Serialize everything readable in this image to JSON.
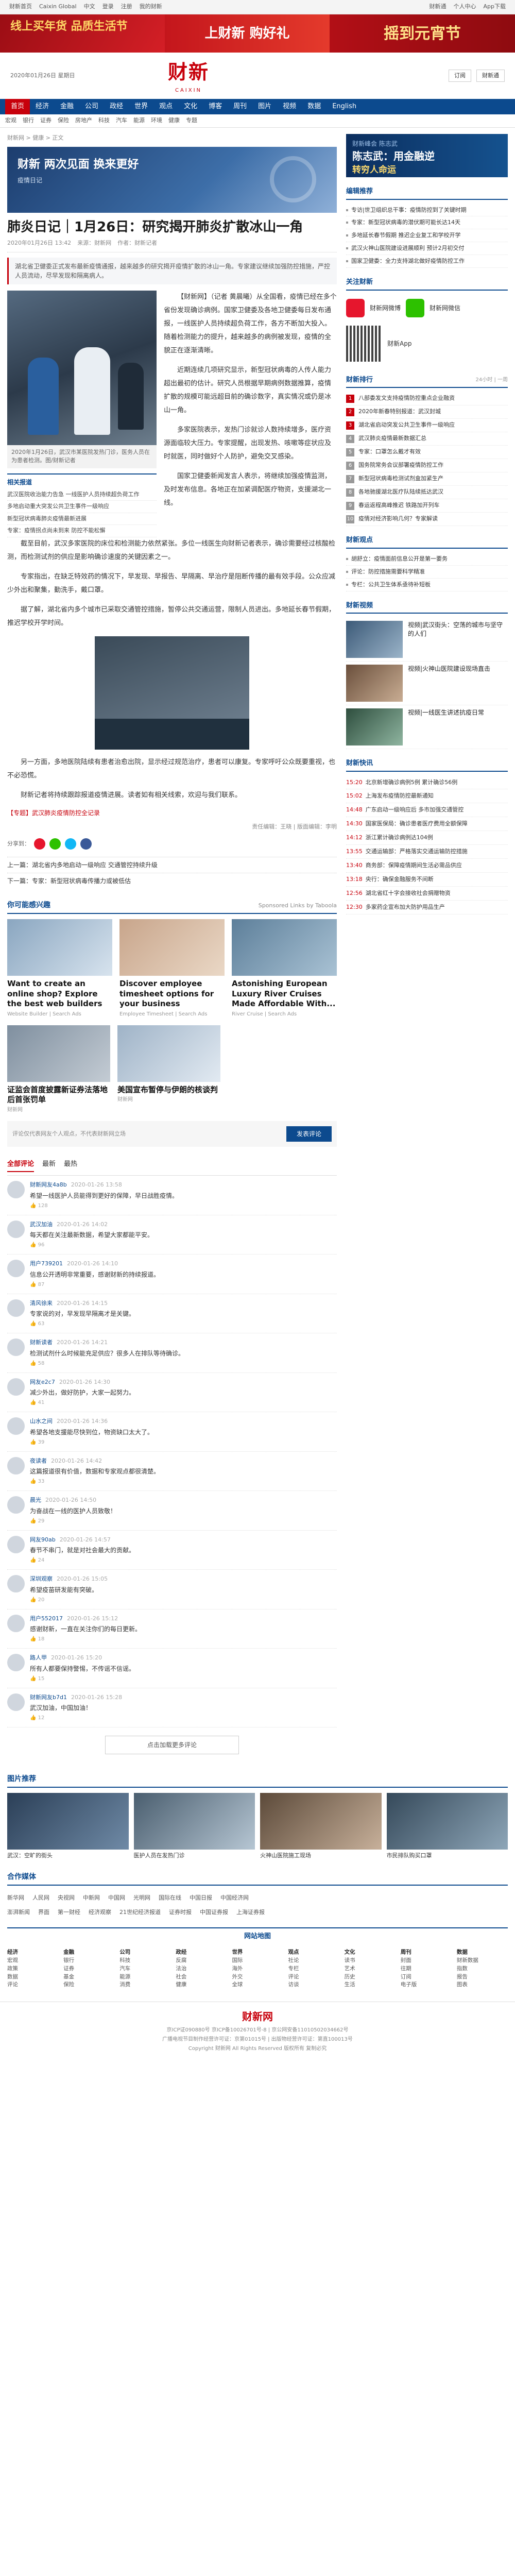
{
  "topbar": {
    "items": [
      "财新首页",
      "Caixin Global",
      "中文",
      "登录",
      "注册",
      "我的财新"
    ],
    "right": [
      "财新通",
      "个人中心",
      "App下载"
    ]
  },
  "adbanner": {
    "left": "线上买年货 品质生活节",
    "mid": "上财新 购好礼",
    "right": "摇到元宵节"
  },
  "masthead": {
    "date": "2020年01月26日 星期日",
    "logo_cn": "财新",
    "logo_en": "CAIXIN",
    "buttons": [
      "订阅",
      "财新通"
    ]
  },
  "nav": {
    "items": [
      "首页",
      "经济",
      "金融",
      "公司",
      "政经",
      "世界",
      "观点",
      "文化",
      "博客",
      "周刊",
      "图片",
      "视频",
      "数据",
      "English"
    ],
    "active": 0
  },
  "subnav": {
    "items": [
      "宏观",
      "银行",
      "证券",
      "保险",
      "房地产",
      "科技",
      "汽车",
      "能源",
      "环境",
      "健康",
      "专题"
    ]
  },
  "crumb": "财新网 > 健康 > 正文",
  "hero": {
    "tag": "财新 两次见面 换来更好",
    "sub": "疫情日记"
  },
  "article": {
    "title": "肺炎日记｜1月26日：研究揭开肺炎扩散冰山一角",
    "meta": [
      "2020年01月26日 13:42",
      "来源：财新网",
      "作者：财新记者"
    ],
    "summary": "湖北省卫健委正式发布最新疫情通报，越来越多的研究揭开疫情扩散的冰山一角。专家建议继续加强防控措施，严控人员流动，尽早发现和隔离病人。",
    "caption": "2020年1月26日，武汉市某医院发热门诊，医务人员在为患者检测。图/财新记者",
    "related_h": "相关报道",
    "related": [
      "武汉医院收治能力告急 一线医护人员持续超负荷工作",
      "多地启动重大突发公共卫生事件一级响应",
      "新型冠状病毒肺炎疫情最新进展",
      "专家：疫情拐点尚未到来 防控不能松懈"
    ],
    "paras": [
      "【财新网】（记者 黄晨曦）从全国看，疫情已经在多个省份发现确诊病例。国家卫健委及各地卫健委每日发布通报，一线医护人员持续超负荷工作，各方不断加大投入。随着检测能力的提升，越来越多的病例被发现，疫情的全貌正在逐渐清晰。",
      "近期连续几项研究显示，新型冠状病毒的人传人能力超出最初的估计。研究人员根据早期病例数据推算，疫情扩散的规模可能远超目前的确诊数字，真实情况或仍是冰山一角。",
      "多家医院表示，发热门诊就诊人数持续增多，医疗资源面临较大压力。专家提醒，出现发热、咳嗽等症状应及时就医，同时做好个人防护，避免交叉感染。",
      "国家卫健委新闻发言人表示，将继续加强疫情监测，及时发布信息。各地正在加紧调配医疗物资，支援湖北一线。"
    ],
    "paras2": [
      "截至目前，武汉多家医院的床位和检测能力依然紧张。多位一线医生向财新记者表示，确诊需要经过核酸检测，而检测试剂的供应是影响确诊速度的关键因素之一。",
      "专家指出，在缺乏特效药的情况下，早发现、早报告、早隔离、早治疗是阻断传播的最有效手段。公众应减少外出和聚集，勤洗手，戴口罩。",
      "据了解，湖北省内多个城市已采取交通管控措施，暂停公共交通运营，限制人员进出。多地延长春节假期，推迟学校开学时间。",
      "另一方面，多地医院陆续有患者治愈出院，显示经过规范治疗，患者可以康复。专家呼吁公众既要重视，也不必恐慌。",
      "财新记者将持续跟踪报道疫情进展。读者如有相关线索，欢迎与我们联系。"
    ],
    "note_red": "【专题】武汉肺炎疫情防控全记录",
    "editor": "责任编辑：王晓 | 版面编辑：李明",
    "share_label": "分享到：",
    "prev": "上一篇：湖北省内多地启动一级响应 交通管控持续升级",
    "next": "下一篇：专家：新型冠状病毒传播力或被低估"
  },
  "recommend": {
    "title": "你可能感兴趣",
    "meta": "Sponsored Links by Taboola",
    "items": [
      {
        "t": "Want to create an online shop? Explore the best web builders",
        "s": "Website Builder | Search Ads"
      },
      {
        "t": "Discover employee timesheet options for your business",
        "s": "Employee Timesheet | Search Ads"
      },
      {
        "t": "Astonishing European Luxury River Cruises Made Affordable With...",
        "s": "River Cruise | Search Ads"
      }
    ],
    "big": [
      {
        "t": "证监会首度披露新证券法落地后首张罚单",
        "s": "财新网"
      },
      {
        "t": "美国宣布暂停与伊朗的核谈判",
        "s": "财新网"
      }
    ]
  },
  "comment": {
    "placeholder": "评论仅代表网友个人观点，不代表财新网立场",
    "btn": "发表评论",
    "tabs": [
      "全部评论",
      "最新",
      "最热"
    ],
    "more": "点击加载更多评论"
  },
  "comments": [
    {
      "name": "财新网友4a8b",
      "time": "2020-01-26 13:58",
      "text": "希望一线医护人员能得到更好的保障，早日战胜疫情。",
      "likes": "128"
    },
    {
      "name": "武汉加油",
      "time": "2020-01-26 14:02",
      "text": "每天都在关注最新数据，希望大家都能平安。",
      "likes": "96"
    },
    {
      "name": "用户739201",
      "time": "2020-01-26 14:10",
      "text": "信息公开透明非常重要，感谢财新的持续报道。",
      "likes": "87"
    },
    {
      "name": "清风徐来",
      "time": "2020-01-26 14:15",
      "text": "专家说的对，早发现早隔离才是关键。",
      "likes": "63"
    },
    {
      "name": "财新读者",
      "time": "2020-01-26 14:21",
      "text": "检测试剂什么时候能充足供应？很多人在排队等待确诊。",
      "likes": "58"
    },
    {
      "name": "网友e2c7",
      "time": "2020-01-26 14:30",
      "text": "减少外出，做好防护，大家一起努力。",
      "likes": "41"
    },
    {
      "name": "山水之间",
      "time": "2020-01-26 14:36",
      "text": "希望各地支援能尽快到位，物资缺口太大了。",
      "likes": "39"
    },
    {
      "name": "夜读者",
      "time": "2020-01-26 14:42",
      "text": "这篇报道很有价值，数据和专家观点都很清楚。",
      "likes": "33"
    },
    {
      "name": "晨光",
      "time": "2020-01-26 14:50",
      "text": "为奋战在一线的医护人员致敬！",
      "likes": "29"
    },
    {
      "name": "网友90ab",
      "time": "2020-01-26 14:57",
      "text": "春节不串门，就是对社会最大的贡献。",
      "likes": "24"
    },
    {
      "name": "深圳观察",
      "time": "2020-01-26 15:05",
      "text": "希望疫苗研发能有突破。",
      "likes": "20"
    },
    {
      "name": "用户552017",
      "time": "2020-01-26 15:12",
      "text": "感谢财新，一直在关注你们的每日更新。",
      "likes": "18"
    },
    {
      "name": "路人甲",
      "time": "2020-01-26 15:20",
      "text": "所有人都要保持警惕，不传谣不信谣。",
      "likes": "15"
    },
    {
      "name": "财新网友b7d1",
      "time": "2020-01-26 15:28",
      "text": "武汉加油，中国加油！",
      "likes": "12"
    }
  ],
  "side": {
    "ad": {
      "t1": "财新峰会 陈志武",
      "t2": "陈志武：用金融逆",
      "t3": "转穷人命运"
    },
    "hot_h": "编辑推荐",
    "hot": [
      "专访|世卫组织总干事：疫情防控到了关键时期",
      "专家：新型冠状病毒的潜伏期可能长达14天",
      "多地延长春节假期 推迟企业复工和学校开学",
      "武汉火神山医院建设进展顺利 预计2月初交付",
      "国家卫健委：全力支持湖北做好疫情防控工作"
    ],
    "follow_h": "关注财新",
    "follow": [
      "财新网微博",
      "财新网微信",
      "财新App"
    ],
    "rank_h": "财新排行",
    "rank_tabs": [
      "24小时",
      "一周"
    ],
    "rank": [
      "八部委发文支持疫情防控重点企业融资",
      "2020年新春特别报道：武汉封城",
      "湖北省启动突发公共卫生事件一级响应",
      "武汉肺炎疫情最新数据汇总",
      "专家：口罩怎么戴才有效",
      "国务院常务会议部署疫情防控工作",
      "新型冠状病毒检测试剂盒加紧生产",
      "各地驰援湖北医疗队陆续抵达武汉",
      "春运返程高峰推迟 铁路加开列车",
      "疫情对经济影响几何？专家解读"
    ],
    "opinion_h": "财新观点",
    "opinions": [
      "胡舒立：疫情面前信息公开是第一要务",
      "评论：防控措施需要科学精准",
      "专栏：公共卫生体系亟待补短板"
    ],
    "cards_h": "财新视频",
    "cards": [
      "视频|武汉街头：空荡的城市与坚守的人们",
      "视频|火神山医院建设现场直击",
      "视频|一线医生讲述抗疫日常"
    ],
    "ts_h": "财新快讯",
    "ts": [
      {
        "tm": "15:20",
        "tx": "北京新增确诊病例5例 累计确诊56例"
      },
      {
        "tm": "15:02",
        "tx": "上海发布疫情防控最新通知"
      },
      {
        "tm": "14:48",
        "tx": "广东启动一级响应后 多市加强交通管控"
      },
      {
        "tm": "14:30",
        "tx": "国家医保局：确诊患者医疗费用全额保障"
      },
      {
        "tm": "14:12",
        "tx": "浙江累计确诊病例达104例"
      },
      {
        "tm": "13:55",
        "tx": "交通运输部：严格落实交通运输防控措施"
      },
      {
        "tm": "13:40",
        "tx": "商务部：保障疫情期间生活必需品供应"
      },
      {
        "tm": "13:18",
        "tx": "央行：确保金融服务不间断"
      },
      {
        "tm": "12:56",
        "tx": "湖北省红十字会接收社会捐赠物资"
      },
      {
        "tm": "12:30",
        "tx": "多家药企宣布加大防护用品生产"
      }
    ]
  },
  "pics": {
    "h": "图片推荐",
    "items": [
      "武汉：空旷的街头",
      "医护人员在发热门诊",
      "火神山医院施工现场",
      "市民排队购买口罩"
    ]
  },
  "links": {
    "h": "合作媒体",
    "row1": [
      "新华网",
      "人民网",
      "央视网",
      "中新网",
      "中国网",
      "光明网",
      "国际在线",
      "中国日报",
      "中国经济网"
    ],
    "row2": [
      "澎湃新闻",
      "界面",
      "第一财经",
      "经济观察",
      "21世纪经济报道",
      "证券时报",
      "中国证券报",
      "上海证券报"
    ]
  },
  "sitemap": {
    "head": "网站地图",
    "cols": [
      {
        "h": "经济",
        "items": [
          "宏观",
          "政策",
          "数据",
          "评论"
        ]
      },
      {
        "h": "金融",
        "items": [
          "银行",
          "证券",
          "基金",
          "保险"
        ]
      },
      {
        "h": "公司",
        "items": [
          "科技",
          "汽车",
          "能源",
          "消费"
        ]
      },
      {
        "h": "政经",
        "items": [
          "反腐",
          "法治",
          "社会",
          "健康"
        ]
      },
      {
        "h": "世界",
        "items": [
          "国际",
          "海外",
          "外交",
          "全球"
        ]
      },
      {
        "h": "观点",
        "items": [
          "社论",
          "专栏",
          "评论",
          "访谈"
        ]
      },
      {
        "h": "文化",
        "items": [
          "读书",
          "艺术",
          "历史",
          "生活"
        ]
      },
      {
        "h": "周刊",
        "items": [
          "封面",
          "往期",
          "订阅",
          "电子版"
        ]
      },
      {
        "h": "数据",
        "items": [
          "财新数据",
          "指数",
          "报告",
          "图表"
        ]
      }
    ]
  },
  "footer": {
    "logo": "财新网",
    "lines": [
      "京ICP证090880号 京ICP备10026701号-8 | 京公网安备11010502034662号",
      "广播电视节目制作经营许可证：京第01015号 | 出版物经营许可证：第直100013号",
      "Copyright 财新网 All Rights Reserved 版权所有 复制必究"
    ]
  }
}
